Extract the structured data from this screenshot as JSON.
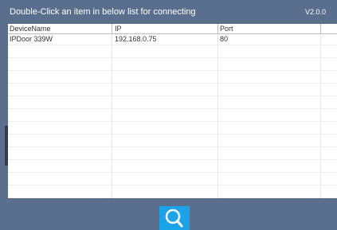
{
  "window": {
    "instruction": "Double-Click an item in below list for connecting",
    "version": "V2.0.0"
  },
  "device_list": {
    "columns": [
      "DeviceName",
      "IP",
      "Port"
    ],
    "rows": [
      {
        "name": "IPDoor 339W",
        "ip": "192.168.0.75",
        "port": "80"
      }
    ]
  },
  "toolbar": {
    "search_icon": "search-icon",
    "accent_color": "#1aa3e8",
    "background_color": "#5a6f8e"
  }
}
